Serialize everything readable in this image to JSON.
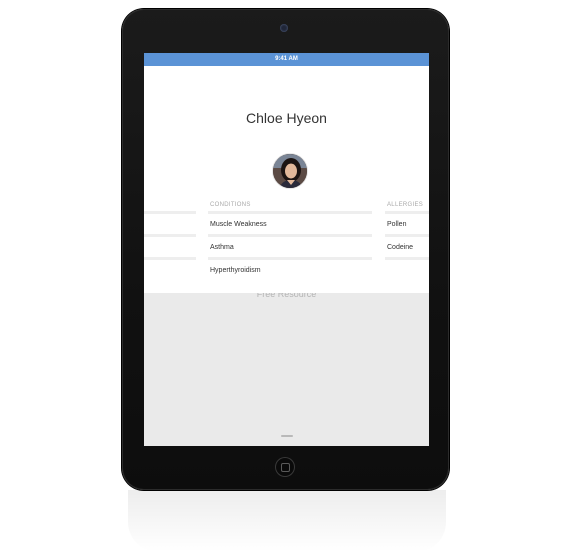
{
  "device": {
    "model": "iPad",
    "frame_color": "#111111"
  },
  "status_bar": {
    "time": "9:41 AM",
    "color": "#5b93d6"
  },
  "patient": {
    "name": "Chloe Hyeon",
    "avatar": "person-photo"
  },
  "columns": [
    {
      "label": "",
      "items": [
        "",
        "",
        ""
      ]
    },
    {
      "label": "CONDITIONS",
      "items": [
        "Muscle Weakness",
        "Asthma",
        "Hyperthyroidism"
      ]
    },
    {
      "label": "ALLERGIES",
      "items": [
        "Pollen",
        "Codeine"
      ]
    }
  ],
  "watermark": "Free Resource"
}
